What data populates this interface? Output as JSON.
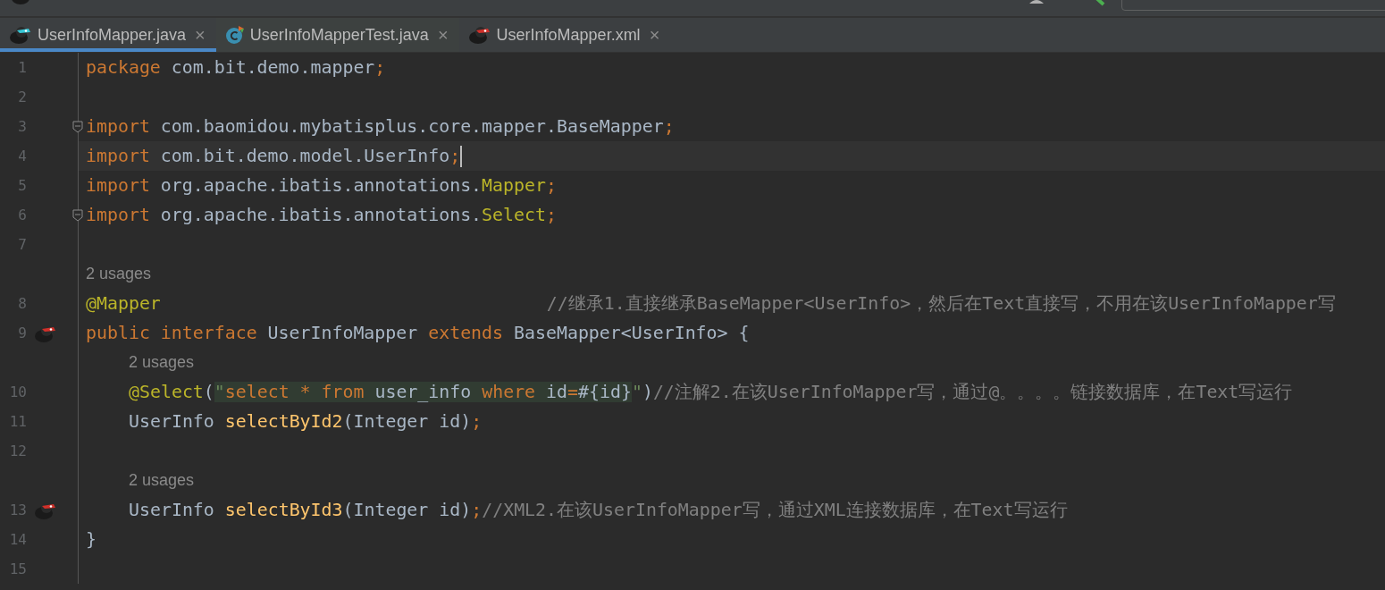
{
  "tabs": [
    {
      "kind": "mapper",
      "label": "UserInfoMapper.java",
      "close": "×",
      "selected": true
    },
    {
      "kind": "test",
      "label": "UserInfoMapperTest.java",
      "close": "×",
      "selected": false
    },
    {
      "kind": "xml",
      "label": "UserInfoMapper.xml",
      "close": "×",
      "selected": false
    }
  ],
  "editor": {
    "lines": [
      {
        "number": "1",
        "tokens": [
          {
            "kind": "keyword",
            "text": "package "
          },
          {
            "kind": "plain",
            "text": "com.bit.demo.mapper"
          },
          {
            "kind": "keyword",
            "text": ";"
          }
        ]
      },
      {
        "number": "2"
      },
      {
        "number": "3",
        "fold": true,
        "tokens": [
          {
            "kind": "keyword",
            "text": "import "
          },
          {
            "kind": "plain",
            "text": "com.baomidou.mybatisplus.core.mapper.BaseMapper"
          },
          {
            "kind": "keyword",
            "text": ";"
          }
        ]
      },
      {
        "number": "4",
        "current": true,
        "tokens": [
          {
            "kind": "keyword",
            "text": "import "
          },
          {
            "kind": "plain",
            "text": "com.bit.demo.model.UserInfo"
          },
          {
            "kind": "keyword",
            "text": ";"
          }
        ]
      },
      {
        "number": "5",
        "tokens": [
          {
            "kind": "keyword",
            "text": "import "
          },
          {
            "kind": "plain",
            "text": "org.apache.ibatis.annotations."
          },
          {
            "kind": "annotation",
            "text": "Mapper"
          },
          {
            "kind": "keyword",
            "text": ";"
          }
        ]
      },
      {
        "number": "6",
        "fold": true,
        "tokens": [
          {
            "kind": "keyword",
            "text": "import "
          },
          {
            "kind": "plain",
            "text": "org.apache.ibatis.annotations."
          },
          {
            "kind": "annotation",
            "text": "Select"
          },
          {
            "kind": "keyword",
            "text": ";"
          }
        ]
      },
      {
        "number": "7"
      },
      {
        "number": "8",
        "hint": "2 usages",
        "tokens": [
          {
            "kind": "annotation",
            "text": "@Mapper"
          },
          {
            "kind": "aligned_comment",
            "text": "//继承1.直接继承BaseMapper<UserInfo>，然后在Text直接写，不用在该UserInfoMapper写"
          }
        ]
      },
      {
        "number": "9",
        "gutter_marker": true,
        "tokens": [
          {
            "kind": "keyword",
            "text": "public interface "
          },
          {
            "kind": "plain",
            "text": "UserInfoMapper "
          },
          {
            "kind": "keyword",
            "text": "extends "
          },
          {
            "kind": "plain",
            "text": "BaseMapper<UserInfo> {"
          }
        ]
      },
      {
        "number": "10",
        "hint": "2 usages",
        "indent": true,
        "tokens": [
          {
            "kind": "annotation",
            "text": "@Select"
          },
          {
            "kind": "plain",
            "text": "("
          },
          {
            "kind": "injected",
            "tokens": [
              {
                "kind": "string",
                "text": "\""
              },
              {
                "kind": "keyword",
                "text": "select * from "
              },
              {
                "kind": "plain",
                "text": "user_info "
              },
              {
                "kind": "keyword",
                "text": "where "
              },
              {
                "kind": "plain",
                "text": "id"
              },
              {
                "kind": "keyword",
                "text": "="
              },
              {
                "kind": "plain",
                "text": "#{id}"
              }
            ]
          },
          {
            "kind": "string",
            "text": "\""
          },
          {
            "kind": "plain",
            "text": ")"
          },
          {
            "kind": "comment",
            "text": "//注解2.在该UserInfoMapper写，通过@。。。。链接数据库，在Text写运行"
          }
        ]
      },
      {
        "number": "11",
        "indent": true,
        "tokens": [
          {
            "kind": "plain",
            "text": "UserInfo "
          },
          {
            "kind": "method",
            "text": "selectById2"
          },
          {
            "kind": "plain",
            "text": "(Integer id)"
          },
          {
            "kind": "keyword",
            "text": ";"
          }
        ]
      },
      {
        "number": "12"
      },
      {
        "number": "13",
        "hint": "2 usages",
        "indent": true,
        "gutter_marker": true,
        "tokens": [
          {
            "kind": "plain",
            "text": "UserInfo "
          },
          {
            "kind": "method",
            "text": "selectById3"
          },
          {
            "kind": "plain",
            "text": "(Integer id)"
          },
          {
            "kind": "keyword",
            "text": ";"
          },
          {
            "kind": "comment",
            "text": "//XML2.在该UserInfoMapper写，通过XML连接数据库，在Text写运行"
          }
        ]
      },
      {
        "number": "14",
        "tokens": [
          {
            "kind": "plain",
            "text": "}"
          }
        ]
      },
      {
        "number": "15"
      }
    ]
  }
}
